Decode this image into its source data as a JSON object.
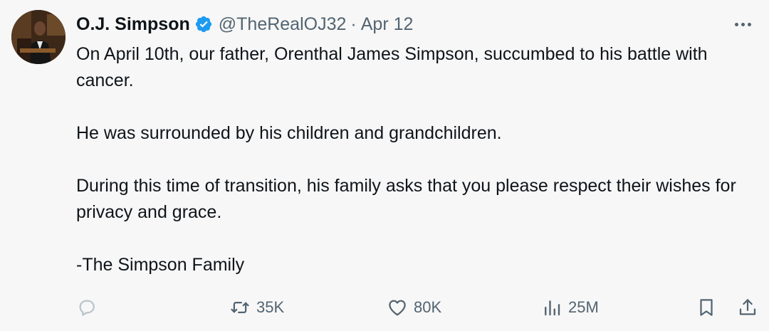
{
  "author": {
    "name": "O.J. Simpson",
    "handle": "@TheRealOJ32",
    "separator": "·",
    "date": "Apr 12",
    "verified": true
  },
  "tweet": {
    "paragraphs": [
      "On April 10th, our father, Orenthal James Simpson, succumbed to his battle with cancer.",
      "He was surrounded by his children and grandchildren.",
      "During this time of transition, his family asks that you please respect their wishes for privacy and grace.",
      "-The Simpson Family"
    ]
  },
  "metrics": {
    "reposts": "35K",
    "likes": "80K",
    "views": "25M"
  },
  "icons": {
    "verified": "verified-badge-icon",
    "more": "more-dots-icon",
    "reply": "reply-bubble-icon",
    "repost": "repost-icon",
    "like": "heart-icon",
    "views": "views-bar-icon",
    "bookmark": "bookmark-icon",
    "share": "share-icon"
  },
  "colors": {
    "background": "#f7f7f7",
    "text": "#0f1419",
    "secondary": "#536471",
    "verified": "#1d9bf0"
  }
}
